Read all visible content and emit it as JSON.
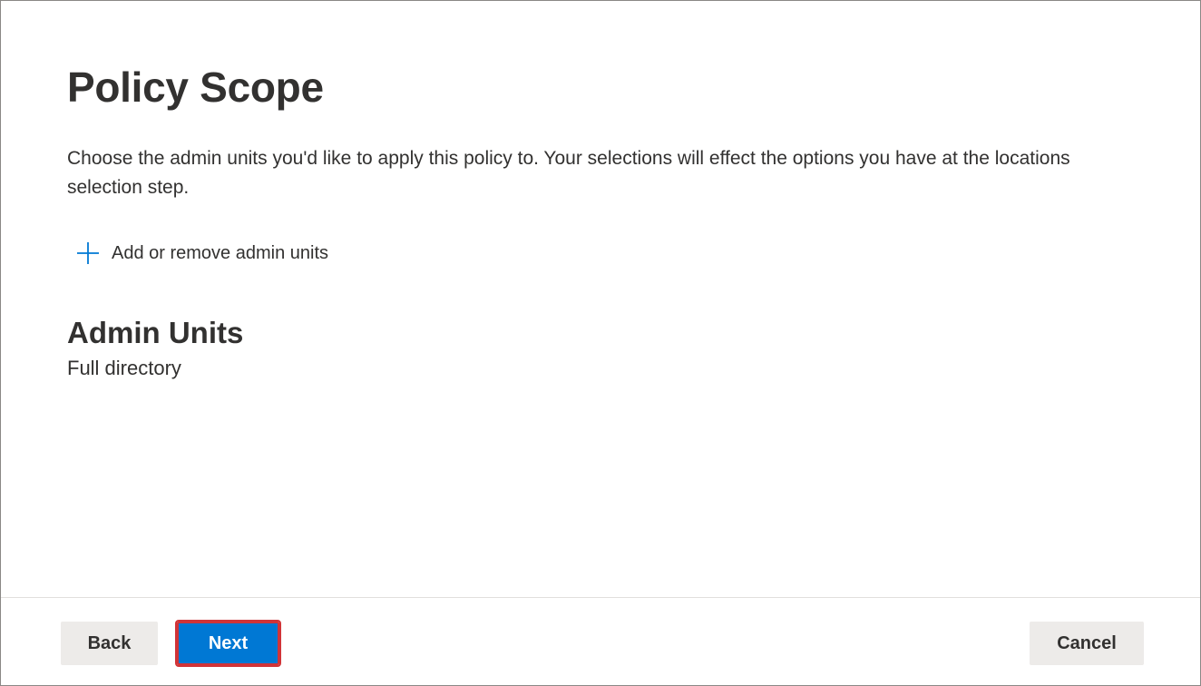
{
  "page": {
    "title": "Policy Scope",
    "description": "Choose the admin units you'd like to apply this policy to. Your selections will effect the options you have at the locations selection step."
  },
  "actions": {
    "add_remove_label": "Add or remove admin units",
    "add_icon": "plus-icon"
  },
  "admin_units": {
    "heading": "Admin Units",
    "value": "Full directory"
  },
  "footer": {
    "back_label": "Back",
    "next_label": "Next",
    "cancel_label": "Cancel"
  },
  "colors": {
    "accent": "#0078d4",
    "highlight_border": "#d13438",
    "secondary_button": "#edebe9",
    "text": "#323130"
  }
}
